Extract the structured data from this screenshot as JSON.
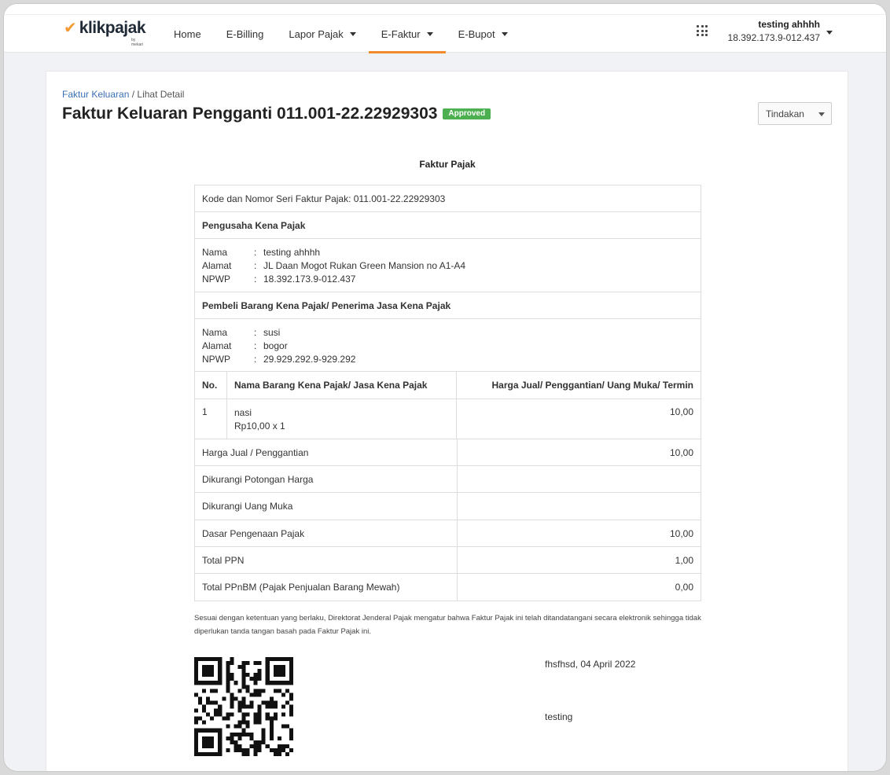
{
  "brand": {
    "logo_text": "klikpajak",
    "logo_sub": "by mekari",
    "accent": "#ef8b2c"
  },
  "nav": {
    "items": [
      {
        "label": "Home",
        "has_caret": false
      },
      {
        "label": "E-Billing",
        "has_caret": false
      },
      {
        "label": "Lapor Pajak",
        "has_caret": true
      },
      {
        "label": "E-Faktur",
        "has_caret": true,
        "active": true
      },
      {
        "label": "E-Bupot",
        "has_caret": true
      }
    ]
  },
  "user": {
    "name": "testing ahhhh",
    "npwp": "18.392.173.9-012.437"
  },
  "breadcrumb": {
    "parent": "Faktur Keluaran",
    "sep": " / ",
    "current": "Lihat Detail"
  },
  "page": {
    "title": "Faktur Keluaran Pengganti 011.001-22.22929303",
    "status": "Approved",
    "status_color": "#4caf50",
    "action_label": "Tindakan"
  },
  "doc": {
    "title": "Faktur Pajak",
    "kode": "Kode dan Nomor Seri Faktur Pajak: 011.001-22.22929303",
    "pkp_heading": "Pengusaha Kena Pajak",
    "pkp": {
      "nama_label": "Nama",
      "nama": "testing ahhhh",
      "alamat_label": "Alamat",
      "alamat": "JL Daan Mogot Rukan Green Mansion no A1-A4",
      "npwp_label": "NPWP",
      "npwp": "18.392.173.9-012.437"
    },
    "pembeli_heading": "Pembeli Barang Kena Pajak/ Penerima Jasa Kena Pajak",
    "pembeli": {
      "nama_label": "Nama",
      "nama": "susi",
      "alamat_label": "Alamat",
      "alamat": "bogor",
      "npwp_label": "NPWP",
      "npwp": "29.929.292.9-929.292"
    },
    "sep": ":",
    "table_headers": {
      "no": "No.",
      "nama": "Nama Barang Kena Pajak/ Jasa Kena Pajak",
      "harga": "Harga Jual/ Penggantian/ Uang Muka/ Termin"
    },
    "items": [
      {
        "no": "1",
        "name": "nasi",
        "detail": "Rp10,00 x 1",
        "amount": "10,00"
      }
    ],
    "summary": [
      {
        "label": "Harga Jual / Penggantian",
        "value": "10,00"
      },
      {
        "label": "Dikurangi Potongan Harga",
        "value": ""
      },
      {
        "label": "Dikurangi Uang Muka",
        "value": ""
      },
      {
        "label": "Dasar Pengenaan Pajak",
        "value": "10,00"
      },
      {
        "label": "Total PPN",
        "value": "1,00"
      },
      {
        "label": "Total PPnBM (Pajak Penjualan Barang Mewah)",
        "value": "0,00"
      }
    ],
    "note": "Sesuai dengan ketentuan yang berlaku, Direktorat Jenderal Pajak mengatur bahwa Faktur Pajak ini telah ditandatangani secara elektronik sehingga tidak diperlukan tanda tangan basah pada Faktur Pajak ini.",
    "sign_place_date": "fhsfhsd, 04 April 2022",
    "sign_name": "testing"
  }
}
